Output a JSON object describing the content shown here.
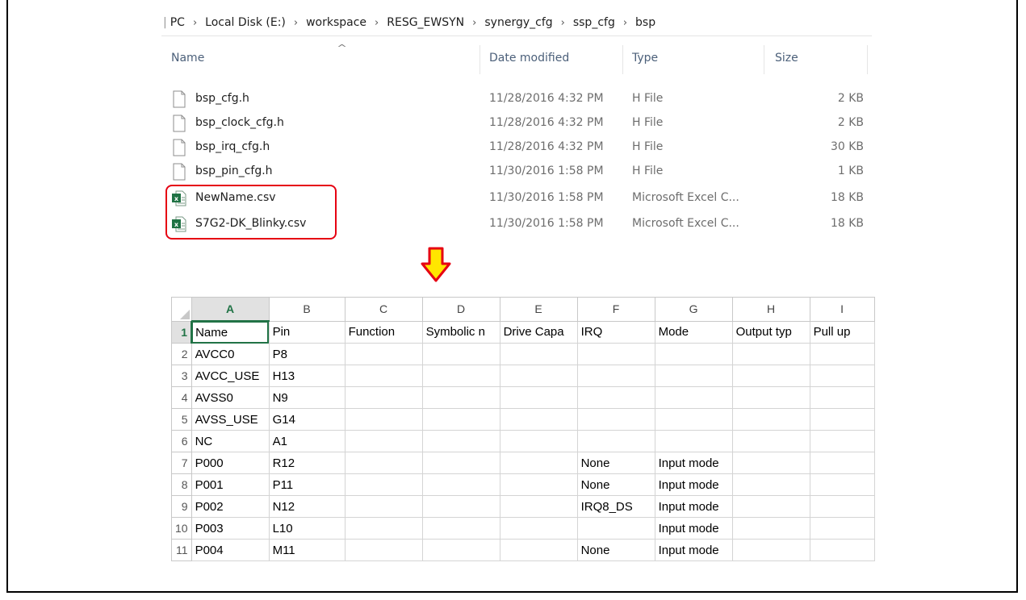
{
  "breadcrumb": [
    "PC",
    "Local Disk (E:)",
    "workspace",
    "RESG_EWSYN",
    "synergy_cfg",
    "ssp_cfg",
    "bsp"
  ],
  "breadcrumb_prefix": "|",
  "columns": {
    "name": "Name",
    "date": "Date modified",
    "type": "Type",
    "size": "Size"
  },
  "files": [
    {
      "name": "bsp_cfg.h",
      "date": "11/28/2016 4:32 PM",
      "type": "H File",
      "size": "2 KB",
      "icon": "blank-file-icon"
    },
    {
      "name": "bsp_clock_cfg.h",
      "date": "11/28/2016 4:32 PM",
      "type": "H File",
      "size": "2 KB",
      "icon": "blank-file-icon"
    },
    {
      "name": "bsp_irq_cfg.h",
      "date": "11/28/2016 4:32 PM",
      "type": "H File",
      "size": "30 KB",
      "icon": "blank-file-icon"
    },
    {
      "name": "bsp_pin_cfg.h",
      "date": "11/30/2016 1:58 PM",
      "type": "H File",
      "size": "1 KB",
      "icon": "blank-file-icon"
    },
    {
      "name": "NewName.csv",
      "date": "11/30/2016 1:58 PM",
      "type": "Microsoft Excel C...",
      "size": "18 KB",
      "icon": "excel-csv-icon"
    },
    {
      "name": "S7G2-DK_Blinky.csv",
      "date": "11/30/2016 1:58 PM",
      "type": "Microsoft Excel C...",
      "size": "18 KB",
      "icon": "excel-csv-icon"
    }
  ],
  "colors": {
    "highlight": "#e60012",
    "arrow_fill": "#ffe600",
    "arrow_stroke": "#e60012",
    "excel_green": "#217346"
  },
  "sheet": {
    "col_headers": [
      "A",
      "B",
      "C",
      "D",
      "E",
      "F",
      "G",
      "H",
      "I"
    ],
    "rows": [
      {
        "n": "1",
        "cells": [
          "Name",
          "Pin",
          "Function",
          "Symbolic n",
          "Drive Capa",
          "IRQ",
          "Mode",
          "Output typ",
          "Pull up"
        ]
      },
      {
        "n": "2",
        "cells": [
          "AVCC0",
          "P8",
          "",
          "",
          "",
          "",
          "",
          "",
          ""
        ]
      },
      {
        "n": "3",
        "cells": [
          "AVCC_USE",
          "H13",
          "",
          "",
          "",
          "",
          "",
          "",
          ""
        ]
      },
      {
        "n": "4",
        "cells": [
          "AVSS0",
          "N9",
          "",
          "",
          "",
          "",
          "",
          "",
          ""
        ]
      },
      {
        "n": "5",
        "cells": [
          "AVSS_USE",
          "G14",
          "",
          "",
          "",
          "",
          "",
          "",
          ""
        ]
      },
      {
        "n": "6",
        "cells": [
          "NC",
          "A1",
          "",
          "",
          "",
          "",
          "",
          "",
          ""
        ]
      },
      {
        "n": "7",
        "cells": [
          "P000",
          "R12",
          "",
          "",
          "",
          "None",
          "Input mode",
          "",
          ""
        ]
      },
      {
        "n": "8",
        "cells": [
          "P001",
          "P11",
          "",
          "",
          "",
          "None",
          "Input mode",
          "",
          ""
        ]
      },
      {
        "n": "9",
        "cells": [
          "P002",
          "N12",
          "",
          "",
          "",
          "IRQ8_DS",
          "Input mode",
          "",
          ""
        ]
      },
      {
        "n": "10",
        "cells": [
          "P003",
          "L10",
          "",
          "",
          "",
          "",
          "Input mode",
          "",
          ""
        ]
      },
      {
        "n": "11",
        "cells": [
          "P004",
          "M11",
          "",
          "",
          "",
          "None",
          "Input mode",
          "",
          ""
        ]
      }
    ]
  }
}
